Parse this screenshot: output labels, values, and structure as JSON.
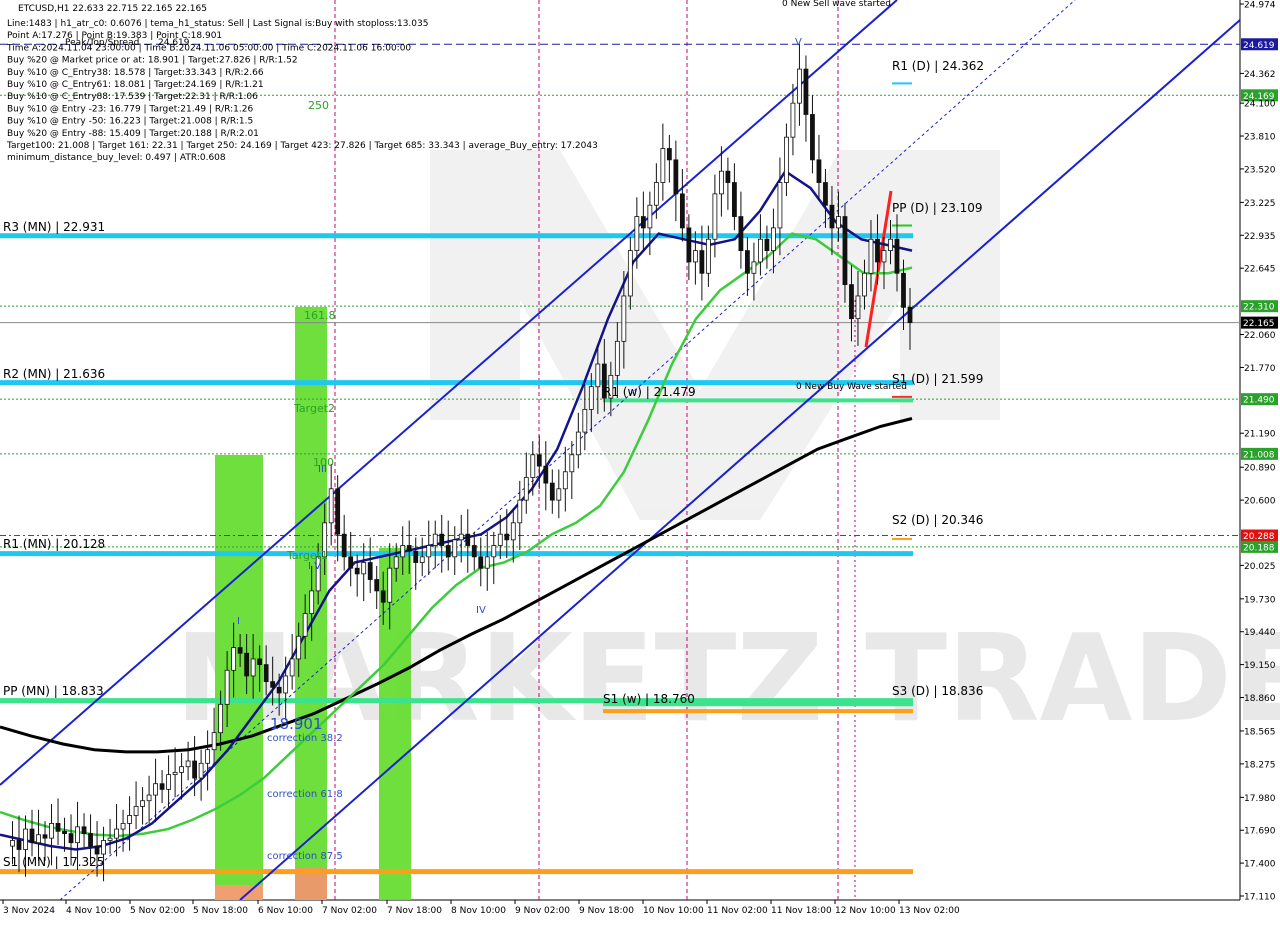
{
  "symbol_line": "ETCUSD,H1  22.633 22.715 22.165 22.165",
  "info_lines": [
    "Line:1483 | h1_atr_c0: 0.6076 | tema_h1_status: Sell | Last Signal is:Buy with stoploss:13.035",
    "Point A:17.276 | Point B:19.383 | Point C:18.901",
    "Time A:2024.11.04 23:00:00 | Time B:2024.11.06 05:00:00 | Time C:2024.11.06 16:00:00",
    "Buy %20 @ Market price or at: 18.901 | Target:27.826 | R/R:1.52",
    "Buy %10 @ C_Entry38: 18.578 | Target:33.343 | R/R:2.66",
    "Buy %10 @ C_Entry61: 18.081 | Target:24.169 | R/R:1.21",
    "Buy %10 @ C_Entry88: 17.539 | Target:22.31 | R/R:1.06",
    "Buy %10 @ Entry -23: 16.779 | Target:21.49 | R/R:1.26",
    "Buy %10 @ Entry -50: 16.223 | Target:21.008 | R/R:1.5",
    "Buy %20 @ Entry -88: 15.409 | Target:20.188 | R/R:2.01",
    "Target100: 21.008 | Target 161: 22.31 | Target 250: 24.169 | Target 423: 27.826 | Target 685: 33.343 | average_Buy_entry: 17.2043",
    "minimum_distance_buy_level: 0.497 | ATR:0.608"
  ],
  "pivot_labels": [
    {
      "text": "R3 (MN) | 22.931",
      "value": 22.931,
      "color": "#1ec8f0"
    },
    {
      "text": "R2 (MN) | 21.636",
      "value": 21.636,
      "color": "#1ec8f0"
    },
    {
      "text": "R1 (MN) | 20.128",
      "value": 20.128,
      "color": "#1ec8f0"
    },
    {
      "text": "PP (MN) | 18.833",
      "value": 18.833,
      "color": "#3ce38c"
    },
    {
      "text": "S1 (MN) | 17.325",
      "value": 17.325,
      "color": "#ff9e1a"
    }
  ],
  "daily_labels": [
    {
      "text": "R1 (D) | 24.362",
      "value": 24.362,
      "color": "#1ec8f0"
    },
    {
      "text": "PP (D) | 23.109",
      "value": 23.109,
      "color": "#22cc22"
    },
    {
      "text": "S1 (D) | 21.599",
      "value": 21.599,
      "color": "#ff2a2a"
    },
    {
      "text": "S2 (D) | 20.346",
      "value": 20.346,
      "color": "#ff9e1a"
    },
    {
      "text": "S3 (D) | 18.836",
      "value": 18.836,
      "color": "#ff9e1a"
    }
  ],
  "weekly_labels": [
    {
      "text": "R1 (w) | 21.479",
      "value": 21.479
    },
    {
      "text": "S1 (w) | 18.760",
      "value": 18.76
    }
  ],
  "annotations": {
    "sell_wave": "0 New Sell wave started",
    "buy_wave": "0 New Buy Wave started",
    "point_c": "18.901",
    "correction_38": "correction 38.2",
    "correction_61": "correction 61.8",
    "correction_87": "correction 87.5",
    "target_161": "161.8",
    "target_250": "250",
    "target_2": "Target2",
    "target_100": "100",
    "target_1": "Target1",
    "wave_v": "V",
    "wave_iv": "IV",
    "wave_i": "I",
    "wave_iii": "III",
    "wave_iv2": "I V",
    "label_peak": "Peak/Top/Spread",
    "label_peak_val": "24.619"
  },
  "watermark": "MARKETZ TRADE",
  "chart_data": {
    "type": "candlestick",
    "ylim": [
      17.11,
      24.974
    ],
    "current_price": 22.165,
    "y_ticks": [
      "24.974",
      "24.619",
      "24.362",
      "24.169",
      "24.100",
      "23.810",
      "23.520",
      "23.225",
      "22.935",
      "22.645",
      "22.310",
      "22.165",
      "22.060",
      "21.770",
      "21.490",
      "21.190",
      "21.008",
      "20.890",
      "20.600",
      "20.288",
      "20.188",
      "20.025",
      "19.730",
      "19.440",
      "19.150",
      "18.860",
      "18.565",
      "18.275",
      "17.980",
      "17.690",
      "17.400",
      "17.110"
    ],
    "x_ticks": [
      "3 Nov 2024",
      "4 Nov 10:00",
      "5 Nov 02:00",
      "5 Nov 18:00",
      "6 Nov 10:00",
      "7 Nov 02:00",
      "7 Nov 18:00",
      "8 Nov 10:00",
      "9 Nov 02:00",
      "9 Nov 18:00",
      "10 Nov 10:00",
      "11 Nov 02:00",
      "11 Nov 18:00",
      "12 Nov 10:00",
      "13 Nov 02:00"
    ],
    "right_tags": [
      {
        "text": "24.619",
        "value": 24.619,
        "color": "#1a1aa0"
      },
      {
        "text": "24.169",
        "value": 24.169,
        "color": "#2aa12a"
      },
      {
        "text": "22.310",
        "value": 22.31,
        "color": "#2aa12a"
      },
      {
        "text": "22.165",
        "value": 22.165,
        "color": "#000000"
      },
      {
        "text": "21.490",
        "value": 21.49,
        "color": "#2aa12a"
      },
      {
        "text": "21.008",
        "value": 21.008,
        "color": "#2aa12a"
      },
      {
        "text": "20.288",
        "value": 20.288,
        "color": "#e01010"
      },
      {
        "text": "20.188",
        "value": 20.188,
        "color": "#2aa12a"
      }
    ],
    "close_path": [
      17.55,
      17.6,
      17.52,
      17.7,
      17.58,
      17.65,
      17.62,
      17.75,
      17.68,
      17.66,
      17.58,
      17.72,
      17.66,
      17.55,
      17.48,
      17.6,
      17.62,
      17.7,
      17.75,
      17.82,
      17.9,
      17.95,
      18.0,
      18.1,
      18.05,
      18.18,
      18.2,
      18.25,
      18.3,
      18.15,
      18.28,
      18.4,
      18.55,
      18.8,
      19.1,
      19.3,
      19.25,
      19.05,
      19.2,
      19.15,
      19.0,
      18.95,
      18.9,
      19.05,
      19.2,
      19.4,
      19.6,
      19.8,
      20.1,
      20.4,
      20.7,
      20.3,
      20.1,
      20.0,
      19.95,
      20.05,
      19.9,
      19.8,
      19.7,
      20.0,
      20.1,
      20.2,
      20.15,
      20.05,
      20.1,
      20.2,
      20.3,
      20.2,
      20.1,
      20.25,
      20.3,
      20.2,
      20.1,
      20.0,
      20.1,
      20.2,
      20.3,
      20.25,
      20.4,
      20.6,
      20.8,
      21.0,
      20.9,
      20.75,
      20.6,
      20.7,
      20.85,
      21.0,
      21.2,
      21.4,
      21.6,
      21.8,
      21.5,
      21.7,
      22.0,
      22.4,
      22.8,
      23.1,
      23.0,
      23.2,
      23.4,
      23.7,
      23.6,
      23.3,
      23.0,
      22.7,
      22.8,
      22.6,
      22.9,
      23.3,
      23.5,
      23.4,
      23.1,
      22.8,
      22.6,
      22.7,
      22.9,
      22.8,
      23.0,
      23.4,
      23.8,
      24.1,
      24.4,
      24.0,
      23.6,
      23.4,
      23.2,
      23.0,
      23.1,
      22.5,
      22.2,
      22.4,
      22.6,
      22.9,
      22.7,
      22.8,
      22.9,
      22.6,
      22.3,
      22.165
    ],
    "ma_green": [
      17.85,
      17.78,
      17.72,
      17.68,
      17.65,
      17.64,
      17.66,
      17.7,
      17.78,
      17.88,
      18.0,
      18.15,
      18.35,
      18.55,
      18.75,
      18.95,
      19.15,
      19.4,
      19.65,
      19.85,
      20.0,
      20.05,
      20.15,
      20.3,
      20.4,
      20.55,
      20.85,
      21.3,
      21.8,
      22.2,
      22.45,
      22.6,
      22.75,
      22.95,
      22.9,
      22.75,
      22.6,
      22.6,
      22.65
    ],
    "ma_black": [
      18.6,
      18.52,
      18.45,
      18.4,
      18.38,
      18.38,
      18.4,
      18.45,
      18.52,
      18.62,
      18.72,
      18.85,
      18.98,
      19.12,
      19.28,
      19.42,
      19.55,
      19.7,
      19.85,
      20.0,
      20.15,
      20.3,
      20.45,
      20.6,
      20.75,
      20.9,
      21.05,
      21.15,
      21.25,
      21.32
    ],
    "ma_blue": [
      17.65,
      17.6,
      17.55,
      17.52,
      17.55,
      17.62,
      17.75,
      17.95,
      18.15,
      18.4,
      18.7,
      19.0,
      19.4,
      19.8,
      20.05,
      20.1,
      20.15,
      20.2,
      20.25,
      20.3,
      20.45,
      20.7,
      21.05,
      21.6,
      22.2,
      22.7,
      22.95,
      22.9,
      22.85,
      22.9,
      23.15,
      23.5,
      23.35,
      23.05,
      22.9,
      22.85,
      22.8
    ]
  }
}
